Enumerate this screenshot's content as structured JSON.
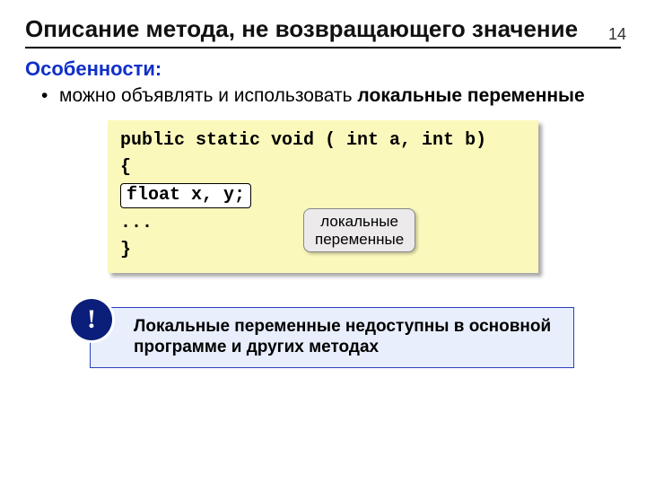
{
  "pageNumber": "14",
  "title": "Описание метода, не возвращающего значение",
  "sectionHeading": "Особенности:",
  "bullet": {
    "prefix": "можно объявлять и использовать ",
    "strong": "локальные переменные"
  },
  "code": {
    "line1": "public static void ( int a, int b)",
    "line2": "{",
    "highlighted": "float x, y;",
    "line4": "...",
    "line5": "}"
  },
  "callout": {
    "line1": "локальные",
    "line2": "переменные"
  },
  "note": {
    "badge": "!",
    "text": "Локальные переменные недоступны в основной программе и других методах"
  }
}
